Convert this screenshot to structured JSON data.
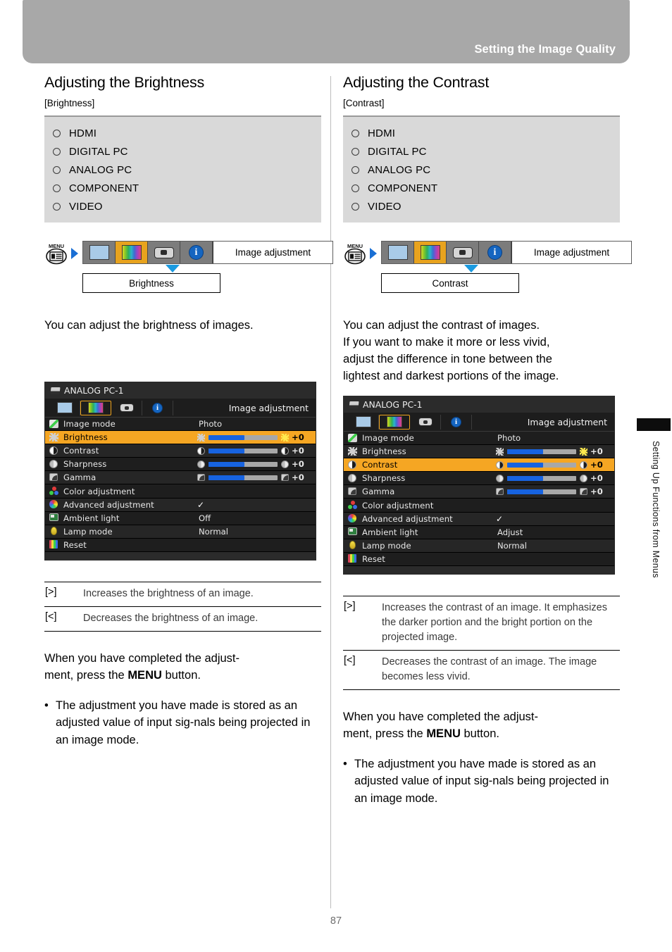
{
  "header": {
    "title": "Setting the Image Quality"
  },
  "page_number": "87",
  "side_tab": {
    "label": "Setting Up Functions from Menus"
  },
  "columns": [
    {
      "title": "Adjusting the Brightness",
      "subtitle": "[Brightness]",
      "signals_left": [
        "HDMI",
        "DIGITAL PC",
        "ANALOG PC"
      ],
      "signals_right": [
        "COMPONENT",
        "VIDEO"
      ],
      "path": {
        "menu_button": "MENU",
        "tab_label": "Image adjustment",
        "item_label": "Brightness",
        "tabs": [
          "input-screen-icon",
          "image-adjustment-icon",
          "projector-setup-icon",
          "system-information-icon"
        ],
        "selected_tab_index": 1
      },
      "body": "You can adjust the brightness of images.",
      "osd": {
        "source": "ANALOG PC-1",
        "tab_title": "Image adjustment",
        "selected_row": "Brightness",
        "rows": [
          {
            "label": "Image mode",
            "icon": "image-mode-icon",
            "type": "text",
            "value": "Photo"
          },
          {
            "label": "Brightness",
            "icon": "brightness-icon",
            "type": "slider",
            "value": "+0",
            "fill_percent": 52
          },
          {
            "label": "Contrast",
            "icon": "contrast-icon",
            "type": "slider",
            "value": "+0",
            "fill_percent": 52
          },
          {
            "label": "Sharpness",
            "icon": "sharpness-icon",
            "type": "slider",
            "value": "+0",
            "fill_percent": 52
          },
          {
            "label": "Gamma",
            "icon": "gamma-icon",
            "type": "slider",
            "value": "+0",
            "fill_percent": 52
          },
          {
            "label": "Color adjustment",
            "icon": "color-adjustment-icon",
            "type": "text",
            "value": ""
          },
          {
            "label": "Advanced adjustment",
            "icon": "advanced-adjustment-icon",
            "type": "check",
            "value": "✓"
          },
          {
            "label": "Ambient light",
            "icon": "ambient-light-icon",
            "type": "text",
            "value": "Off"
          },
          {
            "label": "Lamp mode",
            "icon": "lamp-mode-icon",
            "type": "text",
            "value": "Normal"
          },
          {
            "label": "Reset",
            "icon": "reset-icon",
            "type": "text",
            "value": ""
          }
        ]
      },
      "keys": [
        {
          "key": "[>]",
          "desc": "Increases the brightness of an image."
        },
        {
          "key": "[<]",
          "desc": "Decreases the brightness of an image."
        }
      ],
      "closing": {
        "line1": "When you have completed the adjust-",
        "line2_pre": "ment, press the ",
        "line2_bold": "MENU",
        "line2_post": " button.",
        "bullet": "The adjustment you have made is stored as an adjusted value of input sig-nals being projected in an image mode."
      }
    },
    {
      "title": "Adjusting the Contrast",
      "subtitle": "[Contrast]",
      "signals_left": [
        "HDMI",
        "DIGITAL PC",
        "ANALOG PC"
      ],
      "signals_right": [
        "COMPONENT",
        "VIDEO"
      ],
      "path": {
        "menu_button": "MENU",
        "tab_label": "Image adjustment",
        "item_label": "Contrast",
        "tabs": [
          "input-screen-icon",
          "image-adjustment-icon",
          "projector-setup-icon",
          "system-information-icon"
        ],
        "selected_tab_index": 1
      },
      "body": "You can adjust the contrast of images.\nIf you want to make it more or less vivid,\nadjust the difference in tone between the\nlightest and darkest portions of the image.",
      "osd": {
        "source": "ANALOG PC-1",
        "tab_title": "Image adjustment",
        "selected_row": "Contrast",
        "rows": [
          {
            "label": "Image mode",
            "icon": "image-mode-icon",
            "type": "text",
            "value": "Photo"
          },
          {
            "label": "Brightness",
            "icon": "brightness-icon",
            "type": "slider",
            "value": "+0",
            "fill_percent": 52
          },
          {
            "label": "Contrast",
            "icon": "contrast-icon",
            "type": "slider",
            "value": "+0",
            "fill_percent": 52
          },
          {
            "label": "Sharpness",
            "icon": "sharpness-icon",
            "type": "slider",
            "value": "+0",
            "fill_percent": 52
          },
          {
            "label": "Gamma",
            "icon": "gamma-icon",
            "type": "slider",
            "value": "+0",
            "fill_percent": 52
          },
          {
            "label": "Color adjustment",
            "icon": "color-adjustment-icon",
            "type": "text",
            "value": ""
          },
          {
            "label": "Advanced adjustment",
            "icon": "advanced-adjustment-icon",
            "type": "check",
            "value": "✓"
          },
          {
            "label": "Ambient light",
            "icon": "ambient-light-icon",
            "type": "text",
            "value": "Adjust"
          },
          {
            "label": "Lamp mode",
            "icon": "lamp-mode-icon",
            "type": "text",
            "value": "Normal"
          },
          {
            "label": "Reset",
            "icon": "reset-icon",
            "type": "text",
            "value": ""
          }
        ]
      },
      "keys": [
        {
          "key": "[>]",
          "desc": "Increases the contrast of an image. It emphasizes the darker portion and the bright portion on the projected image."
        },
        {
          "key": "[<]",
          "desc": "Decreases the contrast of an image. The image becomes less vivid."
        }
      ],
      "closing": {
        "line1": "When you have completed the adjust-",
        "line2_pre": "ment, press the ",
        "line2_bold": "MENU",
        "line2_post": " button.",
        "bullet": "The adjustment you have made is stored as an adjusted value of input sig-nals being projected in an image mode."
      }
    }
  ],
  "colors": {
    "header_band": "#a8a8a8",
    "signal_box": "#d9d9d9",
    "osd_highlight": "#f5a623",
    "osd_tab_selected_border": "#f0a51e",
    "slider_fill": "#1763e0",
    "arrow_blue": "#1a6fd4"
  }
}
